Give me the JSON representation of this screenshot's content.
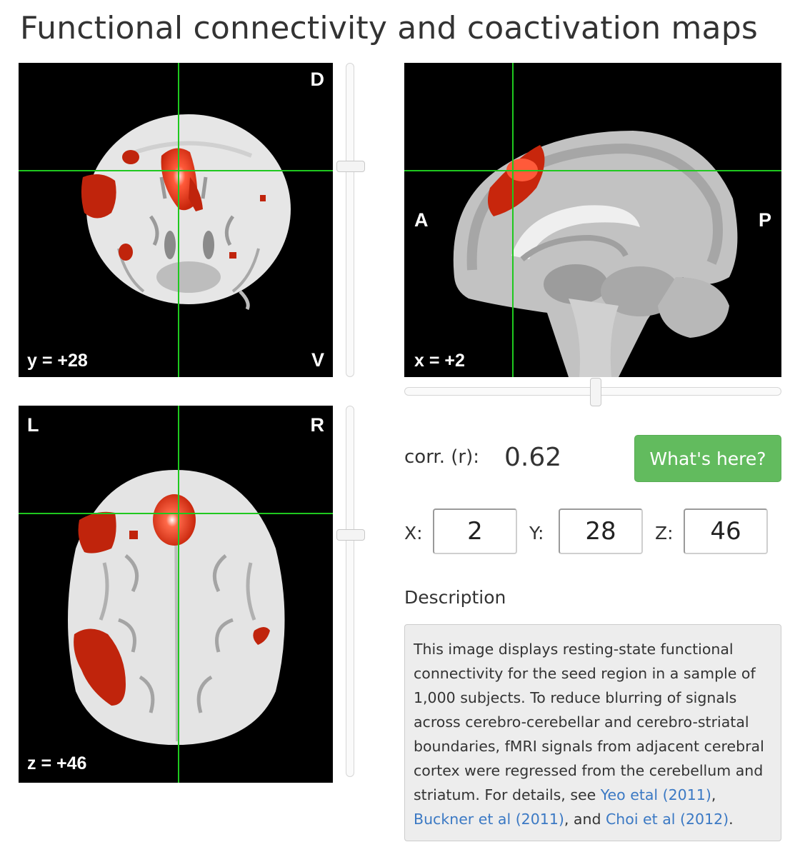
{
  "title": "Functional connectivity and coactivation maps",
  "views": {
    "coronal": {
      "top_label": "D",
      "bottom_label": "V",
      "coord": "y = +28"
    },
    "sagittal": {
      "left_label": "A",
      "right_label": "P",
      "coord": "x = +2"
    },
    "axial": {
      "left_label": "L",
      "right_label": "R",
      "coord": "z = +46"
    }
  },
  "sliders": {
    "coronal_position": 0.33,
    "sagittal_position": 0.51,
    "axial_position": 0.35
  },
  "correlation": {
    "label": "corr. (r):",
    "value": "0.62"
  },
  "whats_here_button": "What's here?",
  "coordinates": {
    "x_label": "X:",
    "x_value": "2",
    "y_label": "Y:",
    "y_value": "28",
    "z_label": "Z:",
    "z_value": "46"
  },
  "description": {
    "heading": "Description",
    "text_before": "This image displays resting-state functional connectivity for the seed region in a sample of 1,000 subjects. To reduce blurring of signals across cerebro-cerebellar and cerebro-striatal boundaries, fMRI signals from adjacent cerebral cortex were regressed from the cerebellum and striatum. For details, see ",
    "link1": "Yeo etal (2011)",
    "sep1": ", ",
    "link2": "Buckner et al (2011)",
    "sep2": ", and ",
    "link3": "Choi et al (2012)",
    "end": "."
  },
  "colors": {
    "crosshair": "#1fc81f",
    "activation": "#c8260c",
    "button": "#62bb5e",
    "link": "#3b79c4"
  }
}
